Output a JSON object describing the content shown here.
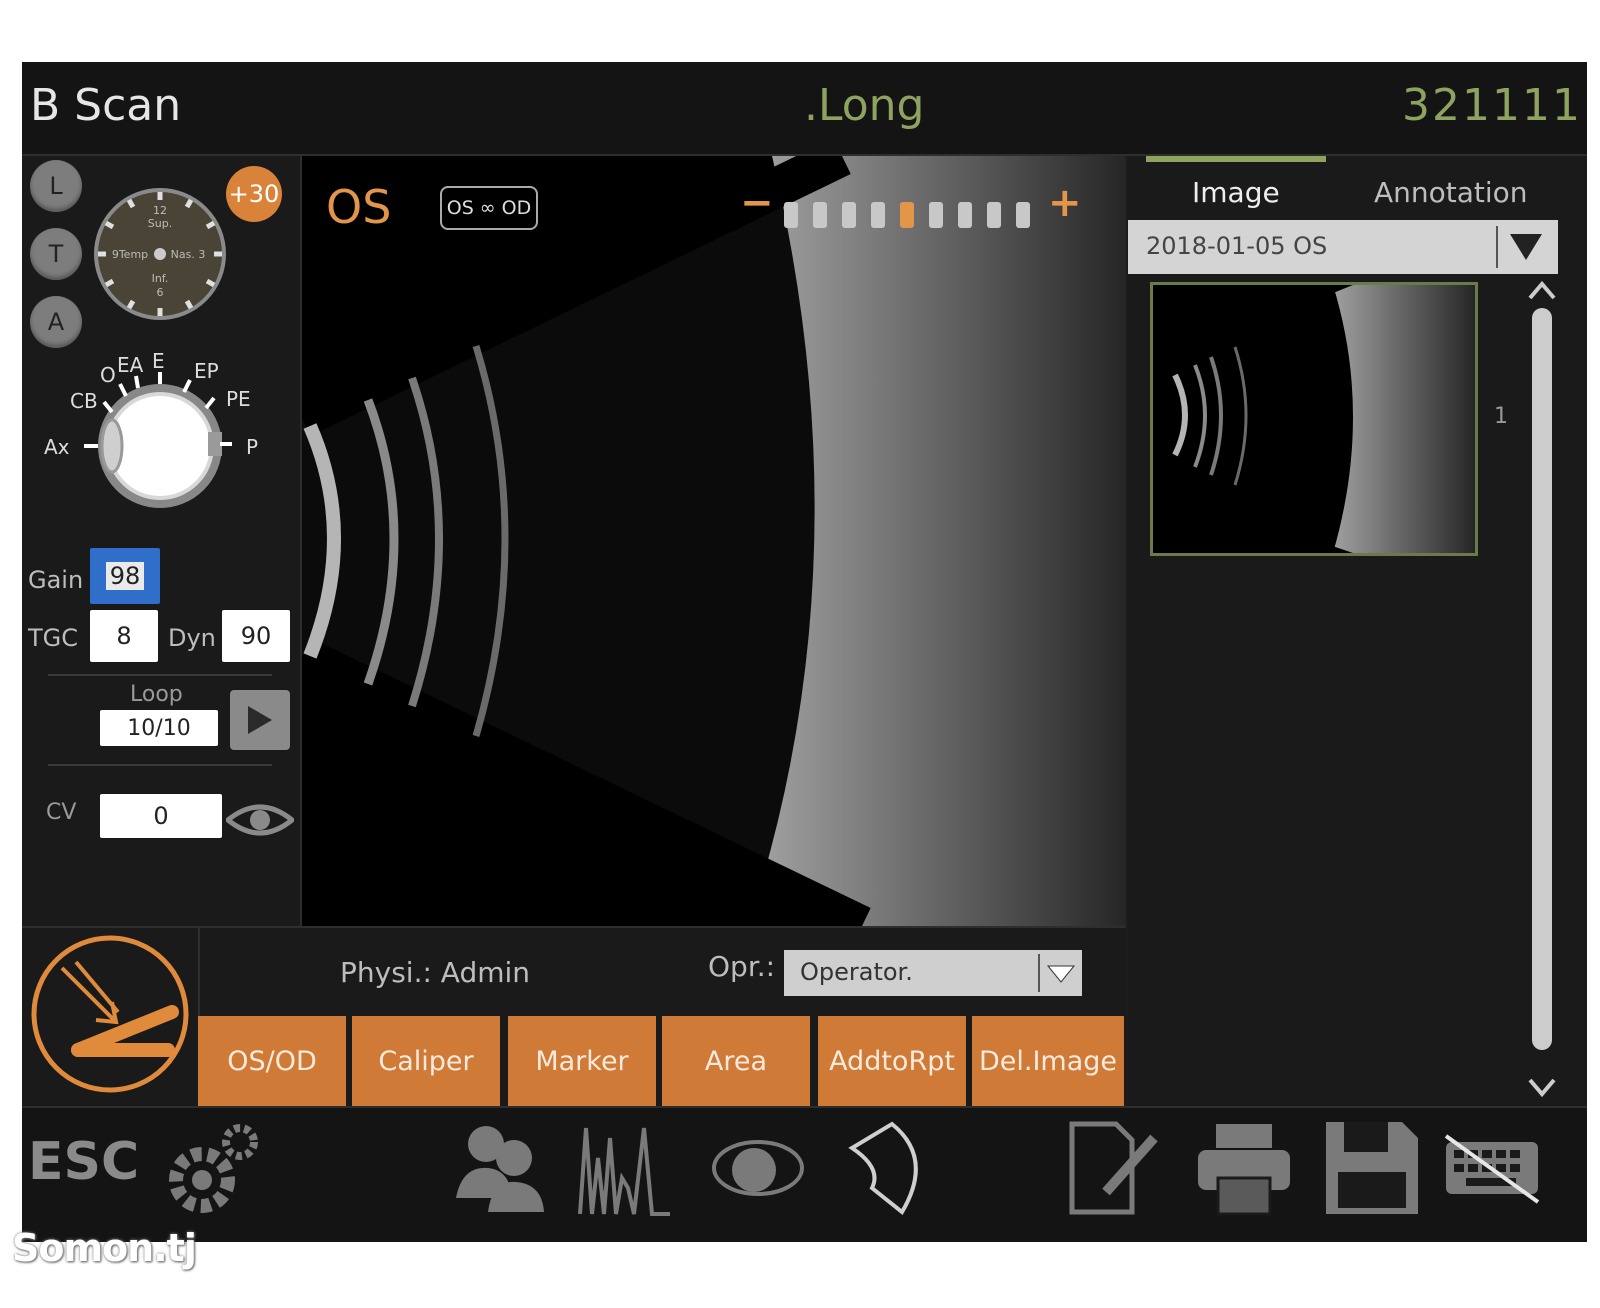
{
  "title": "B Scan",
  "mode": ".Long",
  "patient_id": "321111",
  "probe_buttons": [
    "L",
    "T",
    "A"
  ],
  "angle_badge": "+30",
  "clock_labels": {
    "top": "12",
    "sup": "Sup.",
    "left": "9Temp",
    "right": "Nas. 3",
    "inf": "Inf.",
    "bottom": "6"
  },
  "eye_markers": [
    "O",
    "EA",
    "E",
    "EP",
    "PE",
    "P",
    "CB",
    "Ax"
  ],
  "controls": {
    "gain_label": "Gain",
    "gain_value": "98",
    "tgc_label": "TGC",
    "tgc_value": "8",
    "dyn_label": "Dyn",
    "dyn_value": "90",
    "loop_label": "Loop",
    "loop_value": "10/10",
    "cv_label": "CV",
    "cv_value": "0"
  },
  "scan": {
    "eye": "OS",
    "toggle_label": "OS ∞ OD",
    "minus": "−",
    "plus": "+",
    "level_steps": 9,
    "level_selected": 5,
    "accent": "#e3964a"
  },
  "right_panel": {
    "tabs": [
      "Image",
      "Annotation"
    ],
    "active_tab": "Image",
    "date_select": "2018-01-05 OS",
    "thumb_index": "1"
  },
  "operator_bar": {
    "physician": "Physi.: Admin",
    "operator_label": "Opr.:",
    "operator_value": "Operator.",
    "buttons": [
      "OS/OD",
      "Caliper",
      "Marker",
      "Area",
      "AddtoRpt",
      "Del.Image"
    ]
  },
  "toolbar": {
    "esc_label": "ESC",
    "icons": [
      "settings-icon",
      "patients-icon",
      "waveform-icon",
      "eye-icon",
      "probe-shape-icon",
      "edit-report-icon",
      "print-icon",
      "save-icon",
      "keyboard-off-icon"
    ]
  },
  "watermark": "Somon.tj",
  "colors": {
    "accent_orange": "#cf7a36",
    "accent_green": "#8fa361",
    "panel": "#1a1a1a"
  }
}
